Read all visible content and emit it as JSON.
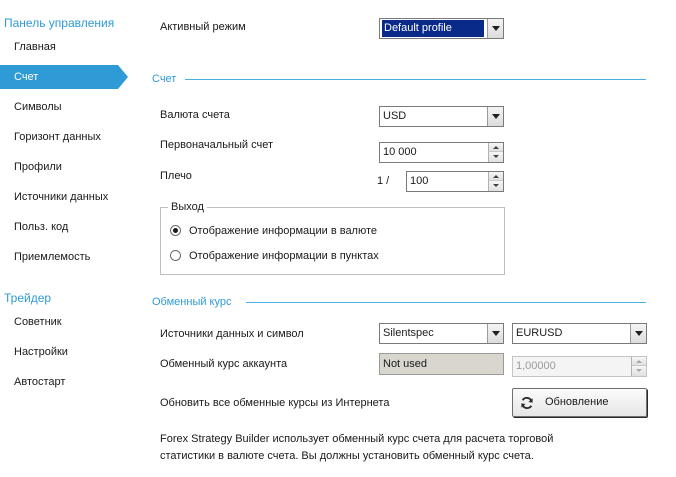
{
  "sidebar": {
    "group1_title": "Панель управления",
    "items1": [
      {
        "label": "Главная"
      },
      {
        "label": "Счет",
        "active": true
      },
      {
        "label": "Символы"
      },
      {
        "label": "Горизонт данных"
      },
      {
        "label": "Профили"
      },
      {
        "label": "Источники данных"
      },
      {
        "label": "Польз. код"
      },
      {
        "label": "Приемлемость"
      }
    ],
    "group2_title": "Трейдер",
    "items2": [
      {
        "label": "Советник"
      },
      {
        "label": "Настройки"
      },
      {
        "label": "Автостарт"
      }
    ]
  },
  "main": {
    "active_mode": {
      "label": "Активный режим",
      "value": "Default profile"
    },
    "account_section": {
      "title": "Счет",
      "currency": {
        "label": "Валюта счета",
        "value": "USD"
      },
      "initial": {
        "label": "Первоначальный счет",
        "value": "10 000"
      },
      "leverage": {
        "label": "Плечо",
        "prefix": "1 /",
        "value": "100"
      },
      "output": {
        "title": "Выход",
        "options": [
          {
            "label": "Отображение информации в валюте",
            "checked": true
          },
          {
            "label": "Отображение информации в пунктах",
            "checked": false
          }
        ]
      }
    },
    "exchange_section": {
      "title": "Обменный курс",
      "source": {
        "label": "Источники данных и символ",
        "source_value": "Silentspec",
        "symbol_value": "EURUSD"
      },
      "rate": {
        "label": "Обменный курс аккаунта",
        "mode_value": "Not used",
        "rate_value": "1,00000"
      },
      "refresh": {
        "label": "Обновить все обменные курсы из Интернета",
        "button_label": "Обновление",
        "icon": "refresh-icon"
      },
      "note_line1": "Forex Strategy Builder использует обменный курс счета для расчета торговой",
      "note_line2": "статистики в валюте счета. Вы должны установить обменный курс счета."
    }
  },
  "colors": {
    "accent": "#2f9bd6",
    "selection": "#0a2a8a"
  }
}
